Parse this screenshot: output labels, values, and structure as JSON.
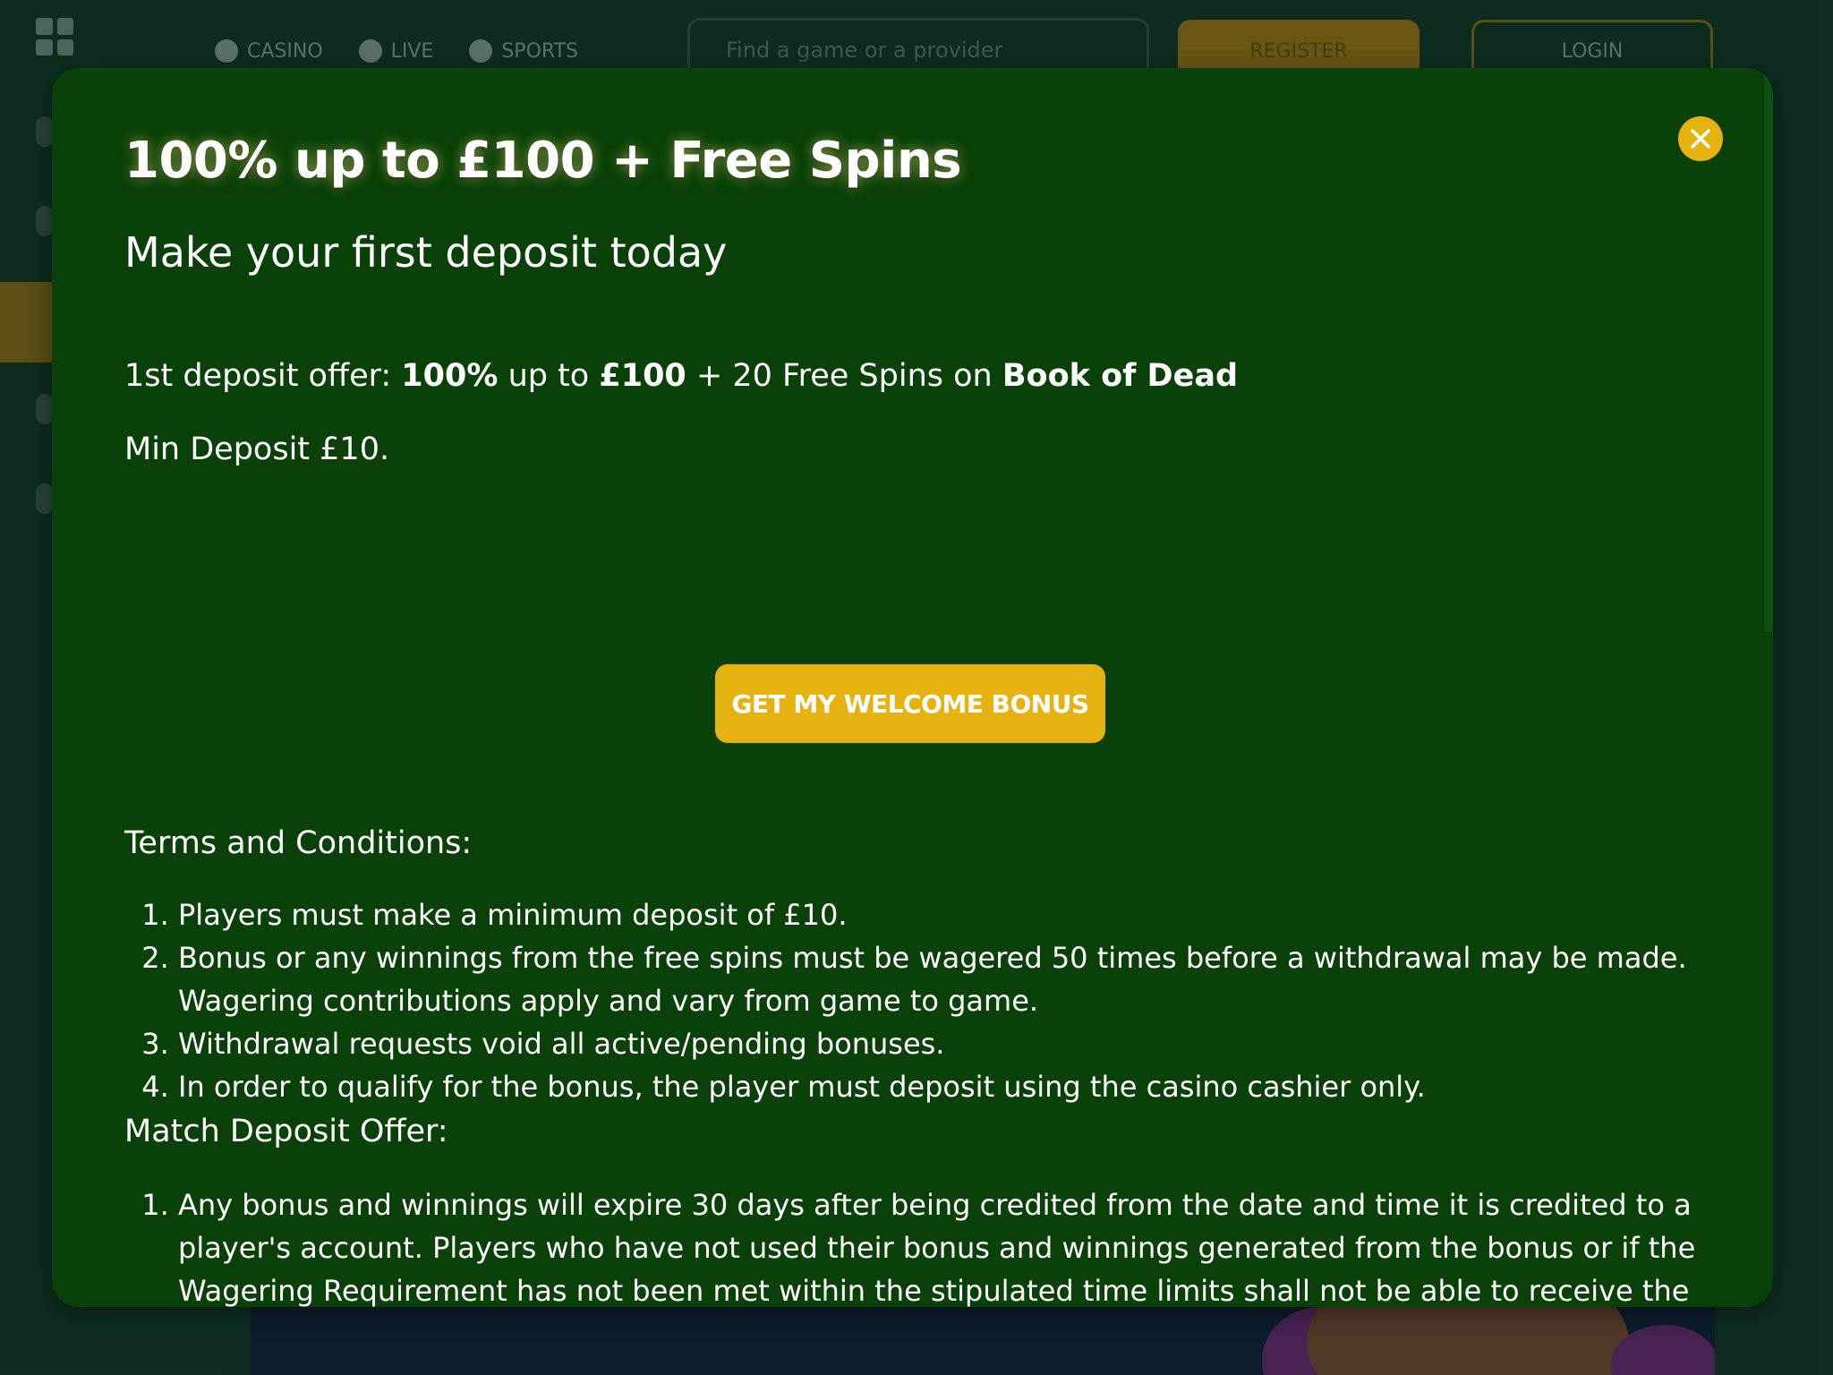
{
  "background": {
    "nav": [
      {
        "icon": "home-icon",
        "label": "CASINO"
      },
      {
        "icon": "live-icon",
        "label": "LIVE"
      },
      {
        "icon": "sports-icon",
        "label": "SPORTS"
      }
    ],
    "search_placeholder": "Find a game or a provider",
    "register_label": "REGISTER",
    "login_label": "LOGIN"
  },
  "modal": {
    "title": "100% up to £100 + Free Spins",
    "subtitle": "Make your first deposit today",
    "offer": {
      "prefix": "1st deposit offer: ",
      "percent": "100%",
      "mid1": " up to ",
      "amount": "£100",
      "mid2": " + 20 Free Spins on ",
      "game": "Book of Dead"
    },
    "min_deposit": "Min Deposit £10.",
    "cta_label": "GET MY WELCOME BONUS",
    "terms_heading": "Terms and Conditions:",
    "terms": [
      "Players must make a minimum deposit of £10.",
      "Bonus or any winnings from the free spins must be wagered 50 times before a withdrawal may be made. Wagering contributions apply and vary from game to game.",
      "Withdrawal requests void all active/pending bonuses.",
      "In order to qualify for the bonus, the player must deposit using the casino cashier only."
    ],
    "match_heading": "Match Deposit Offer:",
    "match_terms": [
      "Any bonus and winnings will expire 30 days after being credited from the date and time it is credited to a player's account. Players who have not used their bonus and winnings generated from the bonus or if the Wagering Requirement has not been met within the stipulated time limits shall not be able to receive the expired bonus and/or winnings generated from the bonus thereafter."
    ]
  },
  "colors": {
    "modal_bg": "#0a4108",
    "accent": "#e5b20f",
    "text": "#ffffff"
  }
}
